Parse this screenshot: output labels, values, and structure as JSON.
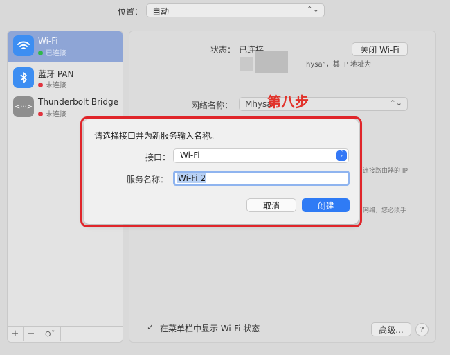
{
  "top": {
    "location_label": "位置：",
    "location_value": "自动"
  },
  "sidebar": {
    "items": [
      {
        "name": "Wi-Fi",
        "status": "已连接",
        "status_color": "#2fb84a",
        "icon": "wifi-icon",
        "selected": true
      },
      {
        "name": "蓝牙 PAN",
        "status": "未连接",
        "status_color": "#e0333e",
        "icon": "bluetooth-icon",
        "selected": false
      },
      {
        "name": "Thunderbolt Bridge",
        "status": "未连接",
        "status_color": "#e0333e",
        "icon": "thunderbolt-bridge-icon",
        "selected": false
      }
    ],
    "tools": {
      "add": "+",
      "remove": "−",
      "more": "⊖˅"
    }
  },
  "panel": {
    "status_label": "状态：",
    "status_value": "已连接",
    "turn_off_button": "关闭 Wi-Fi",
    "status_desc": "hysa”，其 IP 地址为",
    "network_label": "网络名称：",
    "network_value": "Mhysa",
    "hint_1": "连接路由器的 IP",
    "hint_2": "网络，您必须手",
    "menubar_checkbox": "✓",
    "menubar_label": "在菜单栏中显示 Wi-Fi 状态",
    "advanced_button": "高级...",
    "help_button": "?"
  },
  "annotation": {
    "text": "第八步",
    "color": "#e2322a"
  },
  "dialog": {
    "title": "请选择接口并为新服务输入名称。",
    "interface_label": "接口：",
    "interface_value": "Wi-Fi",
    "service_label": "服务名称：",
    "service_value": "Wi-Fi 2",
    "cancel_button": "取消",
    "create_button": "创建",
    "accent": "#2f7bf5"
  }
}
